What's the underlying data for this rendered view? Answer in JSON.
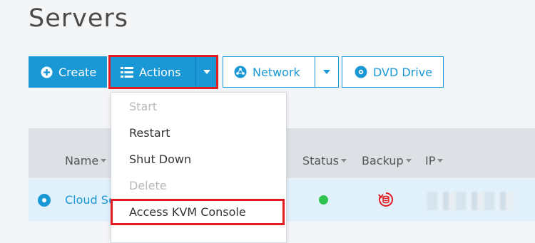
{
  "page": {
    "title": "Servers"
  },
  "toolbar": {
    "create_label": "Create",
    "actions_label": "Actions",
    "network_label": "Network",
    "dvd_label": "DVD Drive"
  },
  "actions_menu": {
    "items": [
      {
        "label": "Start",
        "enabled": false
      },
      {
        "label": "Restart",
        "enabled": true
      },
      {
        "label": "Shut Down",
        "enabled": true
      },
      {
        "label": "Delete",
        "enabled": false
      },
      {
        "label": "Access KVM Console",
        "enabled": true,
        "highlighted": true
      }
    ]
  },
  "table": {
    "columns": [
      "Name",
      "Status",
      "Backup",
      "IP"
    ],
    "rows": [
      {
        "name": "Cloud Se",
        "status": "running",
        "backup": "enabled",
        "ip": ""
      }
    ]
  },
  "colors": {
    "accent": "#1a98d5",
    "highlight": "#e31b23",
    "status_ok": "#2ec24e",
    "backup": "#e31b23"
  }
}
